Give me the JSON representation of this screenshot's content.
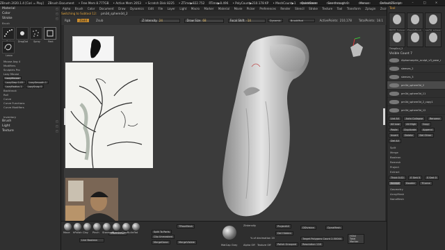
{
  "titlebar": {
    "app": "ZBrush 2020.1.4 [Cori = Play]",
    "document": "ZBrush Document",
    "free_mem": "• Free Mem 8.777GB",
    "active_mem": "• Active Mem 2053",
    "scratch": "• Scratch Disk 8225",
    "ztime": "• ZTime▶822.752",
    "rtime": "RTime▶8.496",
    "poly": "• PolyCount▶210.178 KP",
    "mesh": "• MeshCount▶1",
    "quicksave": "QuickSave",
    "seethrough": "See-through 0",
    "menus": "Menus",
    "defaultscript": "DefaultZScript"
  },
  "menu": [
    "Alpha",
    "Brush",
    "Color",
    "Document",
    "Draw",
    "Dynamics",
    "Edit",
    "File",
    "Layer",
    "Light",
    "Macro",
    "Marker",
    "Material",
    "Movie",
    "Picker",
    "Preferences",
    "Render",
    "Stencil",
    "Stroke",
    "Texture",
    "Tool",
    "Transform",
    "Zplugin",
    "Zscript",
    "Help"
  ],
  "notes": {
    "switching": "Switching to Subtool 12:",
    "subtool_name": "pm3d_sphere3d_2"
  },
  "topstrip": {
    "rgb": "Rgb",
    "zadd": "Zadd",
    "zsub": "Zsub",
    "zintensity_label": "Z Intensity",
    "zintensity_val": "24",
    "drawsize_label": "Draw Size",
    "drawsize_val": "68",
    "focalshift_label": "Focal Shift",
    "focalshift_val": "-14",
    "dynamic": "Dynamic",
    "brushmod": "BrushMod",
    "activepoints_label": "ActivePoints:",
    "activepoints_val": "210,178",
    "totalpoints_label": "TotalPoints:",
    "totalpoints_val": "18.1"
  },
  "left": {
    "material": "Material",
    "color": "Color",
    "stroke": "Stroke",
    "brush_section": "Brush",
    "brushes": [
      {
        "label": "Dots",
        "icon": "dots-stroke-icon"
      },
      {
        "label": "DragDot",
        "icon": "dragdot-stroke-icon"
      },
      {
        "label": "Spray",
        "icon": "spray-stroke-icon"
      },
      {
        "label": "Rect",
        "icon": "rect-stroke-icon"
      },
      {
        "label": "Lasso",
        "icon": "lasso-stroke-icon"
      }
    ],
    "mouse_avg": "Mouse Avg 4",
    "modifiers": "Modifiers",
    "sculptris_pro": "Sculptris Pro",
    "lazy_mouse": "Lazy Mouse",
    "lazymouse_btn": "LazyMouse",
    "lazystep": "LazyStep 0.05",
    "lazysmooth": "LazySmooth 1",
    "lazyradius": "LazyRadius 1",
    "lazysnap": "LazySnap 0",
    "backtrack": "Backtrack",
    "roll": "Roll",
    "curve": "Curve",
    "curve_functions": "Curve Functions",
    "curve_modifiers": "Curve Modifiers",
    "inventory": "Inventory",
    "brush2": "Brush",
    "light": "Light",
    "texture": "Texture"
  },
  "bottom": {
    "brushes": [
      "Move",
      "hPolish",
      "Clay",
      "Pinch",
      "Standard",
      "Standar",
      "ClayBui",
      "Inflat"
    ],
    "live_boolean": "Live Boolean",
    "trymesh": "TPoseMesh",
    "split_to_parts": "Split To Parts",
    "clip_unmasked": "Clip Unmasked",
    "zremesher": "ZRemesher",
    "merge_down": "MergeDown",
    "merge_visible": "MergeVisible",
    "dynamesh": "DynaMesh",
    "dynamesh_btn": "DynaMesh",
    "project_all": "ProjectAll",
    "dominoes": "DDivision",
    "delete_hidden": "Del Hidden",
    "polish_grouped": "Polish Grouped",
    "target_polygons": "Target Polygons Count 2.50044",
    "resolution": "Resolution 128",
    "hold_btn": "HOld Total Marker",
    "zintensity": "ZIntensity",
    "alpha_off": "Alpha Off",
    "texture_off": "Texture Off",
    "mat_label": "MatCap Gray",
    "bottom_pct": "% of decimation 20"
  },
  "right": {
    "tool_head": "Tool",
    "thumbs": [
      {
        "label": "PM3D_Sphere"
      },
      {
        "label": "SimpleBrush"
      },
      {
        "label": "pm3d_sphere"
      },
      {
        "label": "ThingScul_3"
      },
      {
        "label": ""
      },
      {
        "label": ""
      }
    ],
    "subtool_head": "Visible Count 7",
    "subtools": [
      {
        "name": "Alphomorphic_sculpt_v3_pose_r",
        "active": false
      },
      {
        "name": "sleeves_2",
        "active": false
      },
      {
        "name": "sleeves_3",
        "active": false
      },
      {
        "name": "pm3d_sphere3d_2",
        "active": true
      },
      {
        "name": "pm3d_sphere3d_11",
        "active": false
      },
      {
        "name": "pm3d_sphere3d_2_copy1",
        "active": false
      },
      {
        "name": "pm3d_sphere3d_12",
        "active": false
      }
    ],
    "list_all": "List All",
    "auto_collapse": "Auto Collapse",
    "rename": "Rename",
    "all_low": "All Low",
    "all_high": "All High",
    "copy": "Copy",
    "paste": "Paste",
    "duplicate": "Duplicate",
    "append": "Append",
    "insert": "Insert",
    "delete": "Delete",
    "del_other": "Del Other",
    "del_all": "Del All",
    "split": "Split",
    "merge": "Merge",
    "boolean": "Boolean",
    "remesh": "Remesh",
    "project": "Project",
    "extract": "Extract",
    "thick": "Thick 0.02",
    "e_smt": "E Smt 5",
    "s_smt": "S Smt 0",
    "accept": "Accept",
    "double": "Double",
    "tcorne": "TCorne",
    "geometry": "Geometry",
    "array_mesh": "ArrayMesh",
    "nanomesh": "NanoMesh"
  },
  "colors": {
    "accent": "#e2a43c",
    "panel": "#303030",
    "canvas": "#3b3b3b"
  }
}
